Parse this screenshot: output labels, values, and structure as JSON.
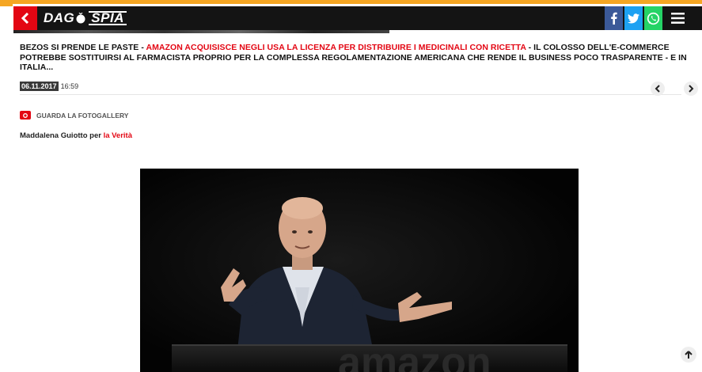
{
  "header": {
    "logo_left": "DAG",
    "logo_right": "SPIA"
  },
  "article": {
    "headline_part1": "BEZOS SI PRENDE LE PASTE - ",
    "headline_highlight": "AMAZON ACQUISISCE NEGLI USA LA LICENZA PER DISTRIBUIRE I MEDICINALI CON RICETTA",
    "headline_part2": " - IL COLOSSO DELL'E-COMMERCE POTREBBE SOSTITUIRSI AL FARMACISTA PROPRIO PER LA COMPLESSA REGOLAMENTAZIONE AMERICANA CHE RENDE IL BUSINESS POCO TRASPARENTE - E IN ITALIA...",
    "date": "06.11.2017",
    "time": "16:59",
    "gallery_label": "GUARDA LA FOTOGALLERY",
    "byline_author": "Maddalena Guiotto per ",
    "byline_source": "la Verità"
  },
  "colors": {
    "brand_red": "#e30613",
    "accent_orange": "#f5a623",
    "header_black": "#141414",
    "facebook": "#3b5998",
    "twitter": "#1da1f2",
    "whatsapp": "#25d366"
  },
  "icons": [
    "back-arrow-icon",
    "facebook-icon",
    "twitter-icon",
    "whatsapp-icon",
    "hamburger-menu-icon",
    "camera-icon",
    "chevron-left-icon",
    "chevron-right-icon",
    "arrow-up-icon"
  ]
}
